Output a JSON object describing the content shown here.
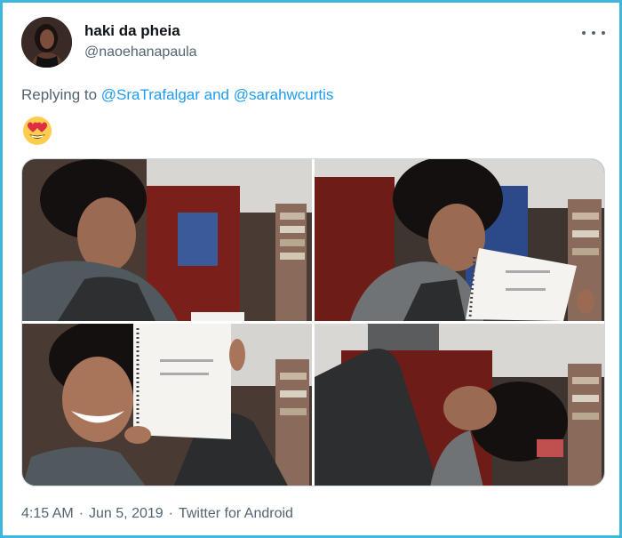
{
  "tweet": {
    "display_name": "haki da pheia",
    "handle": "@naoehanapaula",
    "reply_prefix": "Replying to",
    "reply_mention_1": "@SraTrafalgar",
    "reply_conjunction": "and",
    "reply_mention_2": "@sarahwcurtis",
    "emoji": "smiling-face-with-heart-eyes",
    "time": "4:15 AM",
    "date": "Jun 5, 2019",
    "source": "Twitter for Android",
    "separator": "·"
  },
  "colors": {
    "border": "#3fb6dd",
    "link": "#1d9bf0",
    "secondary_text": "#536471",
    "primary_text": "#0f1419"
  },
  "icons": [
    "more-options-icon",
    "heart-eyes-emoji"
  ]
}
